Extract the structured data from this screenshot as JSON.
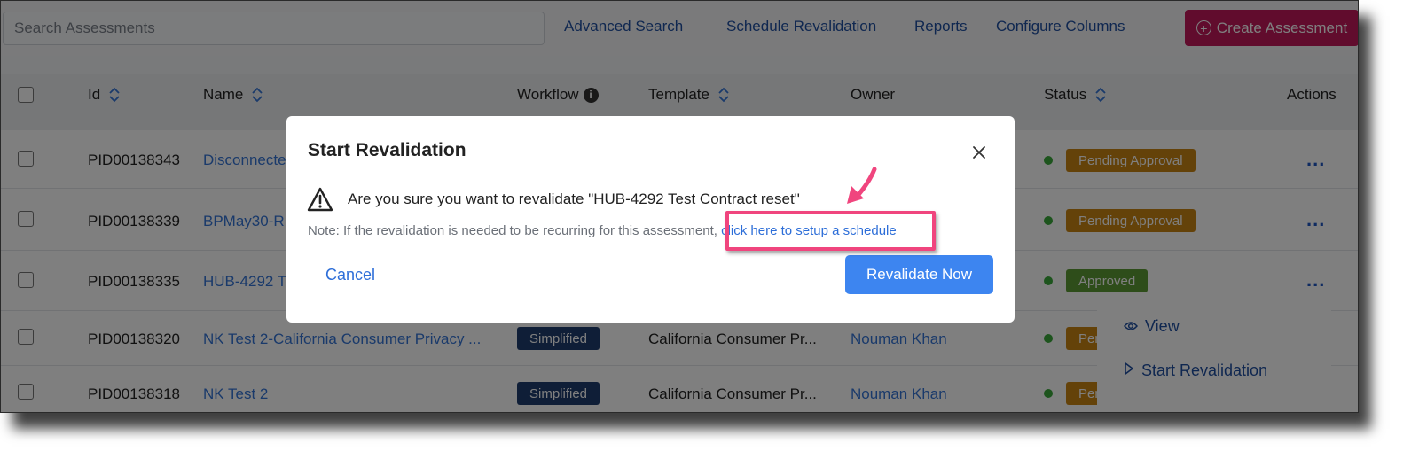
{
  "toolbar": {
    "search_placeholder": "Search Assessments",
    "links": [
      "Advanced Search",
      "Schedule Revalidation",
      "Reports",
      "Configure Columns"
    ],
    "create_label": "Create Assessment"
  },
  "table": {
    "headers": {
      "id": "Id",
      "name": "Name",
      "workflow": "Workflow",
      "template": "Template",
      "owner": "Owner",
      "status": "Status",
      "actions": "Actions"
    },
    "rows": [
      {
        "id": "PID00138343",
        "name": "Disconnecte",
        "workflow": "",
        "template": "",
        "owner": "",
        "status": "Pending Approval"
      },
      {
        "id": "PID00138339",
        "name": "BPMay30-RF",
        "workflow": "",
        "template": "",
        "owner": "",
        "status": "Pending Approval"
      },
      {
        "id": "PID00138335",
        "name": "HUB-4292 Te",
        "workflow": "",
        "template": "",
        "owner": "",
        "status": "Approved"
      },
      {
        "id": "PID00138320",
        "name": "NK Test 2-California Consumer Privacy ...",
        "workflow": "Simplified",
        "template": "California Consumer Pr...",
        "owner": "Nouman Khan",
        "status": "Per"
      },
      {
        "id": "PID00138318",
        "name": "NK Test 2",
        "workflow": "Simplified",
        "template": "California Consumer Pr...",
        "owner": "Nouman Khan",
        "status": "Per"
      }
    ],
    "actions_glyph": "..."
  },
  "action_menu": {
    "items": [
      "View",
      "Start Revalidation"
    ]
  },
  "modal": {
    "title": "Start Revalidation",
    "message": "Are you sure you want to revalidate \"HUB-4292 Test Contract reset\"",
    "note_prefix": "Note: If the revalidation is needed to be recurring for this assessment,",
    "note_link": "click here to setup a schedule",
    "cancel_label": "Cancel",
    "confirm_label": "Revalidate Now"
  },
  "colors": {
    "primary": "#3d85f0",
    "create_button": "#c2185b",
    "pending": "#c98413",
    "approved": "#5d9a35",
    "workflow_badge": "#1f3c6e",
    "annotation": "#f0457e"
  },
  "icons": [
    "plus-circle-icon",
    "sort-icon",
    "info-icon",
    "status-dot-icon",
    "more-icon",
    "eye-icon",
    "play-icon",
    "close-icon",
    "warning-icon",
    "annotation-arrow-icon"
  ]
}
